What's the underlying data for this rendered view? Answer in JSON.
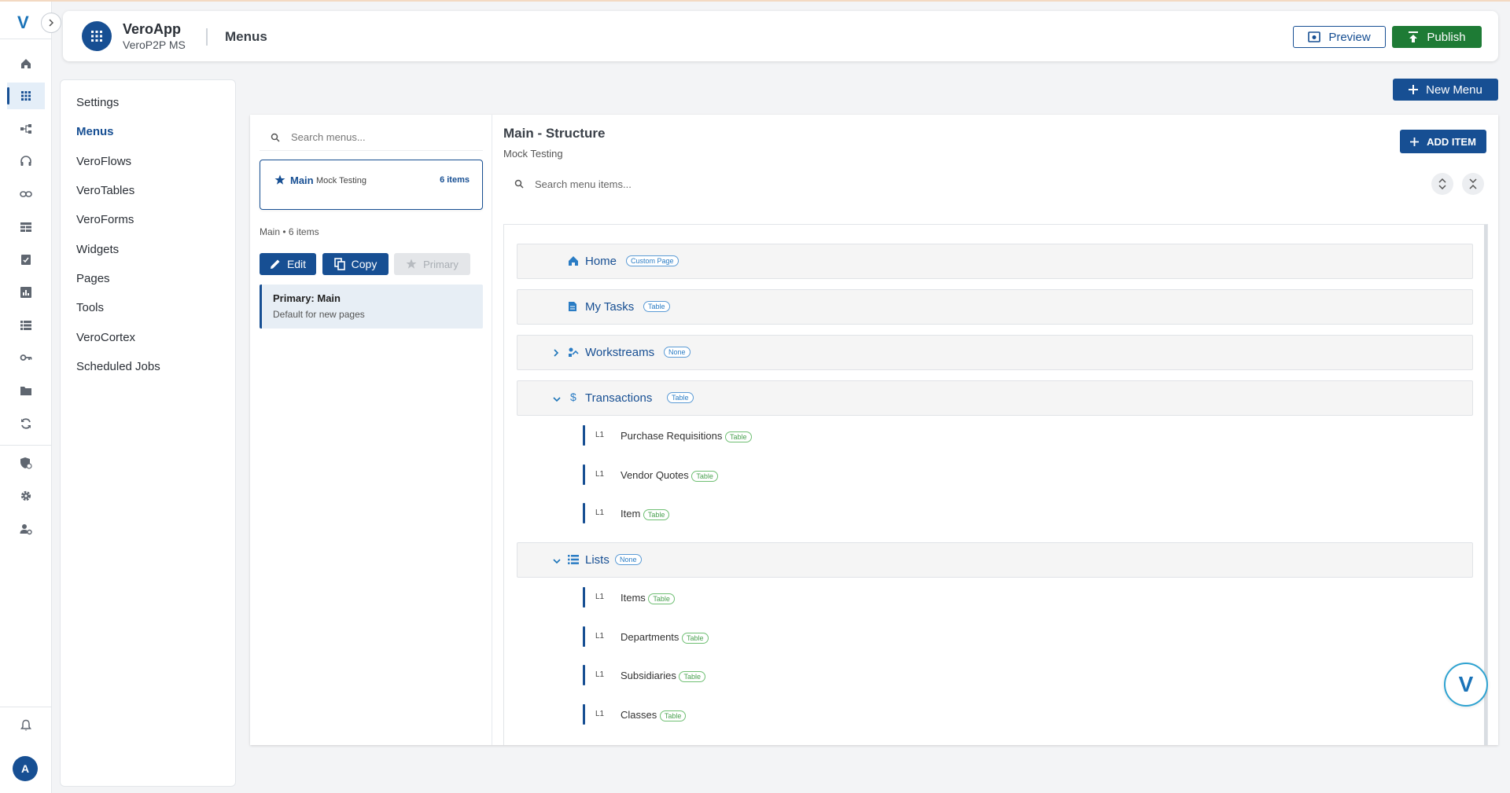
{
  "rail": {
    "logo": "V",
    "avatar_initial": "A",
    "icons": [
      "home-icon",
      "apps-grid-icon",
      "flow-icon",
      "support-icon",
      "link-icon",
      "table-icon",
      "forms-icon",
      "chart-icon",
      "list-icon",
      "key-icon",
      "folder-icon",
      "sync-icon",
      "security-icon",
      "settings-icon",
      "user-settings-icon",
      "bell-icon"
    ]
  },
  "header": {
    "app_name": "VeroApp",
    "app_subtitle": "VeroP2P MS",
    "page_title": "Menus",
    "preview_label": "Preview",
    "publish_label": "Publish"
  },
  "nav": {
    "items": [
      "Settings",
      "Menus",
      "VeroFlows",
      "VeroTables",
      "VeroForms",
      "Widgets",
      "Pages",
      "Tools",
      "VeroCortex",
      "Scheduled Jobs"
    ],
    "active": "Menus"
  },
  "toolbar": {
    "new_menu_label": "New Menu"
  },
  "menus": {
    "search_placeholder": "Search menus...",
    "card": {
      "name": "Main",
      "description": "Mock Testing",
      "count": "6 items"
    },
    "meta_name": "Main",
    "meta_count": "6 items",
    "edit_label": "Edit",
    "copy_label": "Copy",
    "primary_label": "Primary",
    "primary_title": "Primary: Main",
    "primary_desc": "Default for new pages"
  },
  "structure": {
    "title": "Main - Structure",
    "subtitle": "Mock Testing",
    "add_item_label": "ADD ITEM",
    "search_placeholder": "Search menu items...",
    "nodes": [
      {
        "label": "Home",
        "type": "Custom Page",
        "icon": "home-icon"
      },
      {
        "label": "My Tasks",
        "type": "Table",
        "icon": "document-icon"
      },
      {
        "label": "Workstreams",
        "type": "None",
        "icon": "workstream-icon",
        "expander": "collapsed"
      },
      {
        "label": "Transactions",
        "type": "Table",
        "icon": "dollar-icon",
        "expander": "expanded",
        "children": [
          {
            "level": "L1",
            "label": "Purchase Requisitions",
            "type": "Table"
          },
          {
            "level": "L1",
            "label": "Vendor Quotes",
            "type": "Table"
          },
          {
            "level": "L1",
            "label": "Item",
            "type": "Table"
          }
        ]
      },
      {
        "label": "Lists",
        "type": "None",
        "icon": "list-icon",
        "expander": "expanded",
        "children": [
          {
            "level": "L1",
            "label": "Items",
            "type": "Table"
          },
          {
            "level": "L1",
            "label": "Departments",
            "type": "Table"
          },
          {
            "level": "L1",
            "label": "Subsidiaries",
            "type": "Table"
          },
          {
            "level": "L1",
            "label": "Classes",
            "type": "Table"
          }
        ]
      }
    ]
  },
  "colors": {
    "primary": "#174f93",
    "publish": "#1e7b35",
    "badge_blue": "#2a7cc4",
    "badge_green": "#4aa150"
  }
}
